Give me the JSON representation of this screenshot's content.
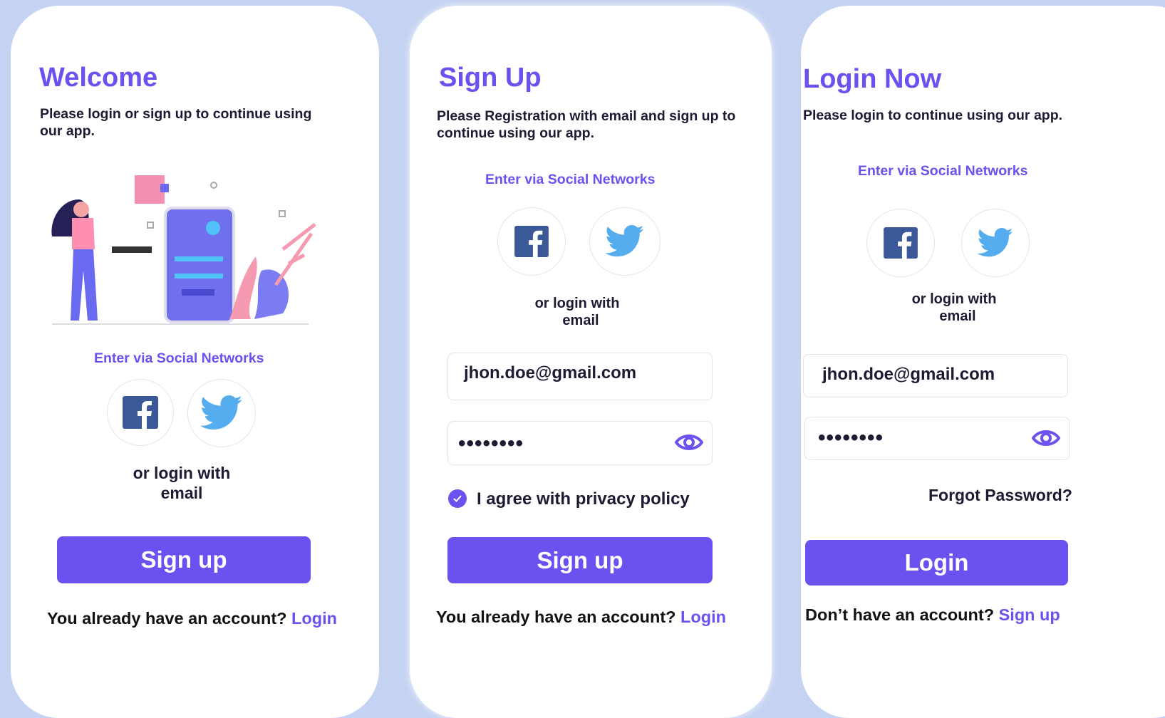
{
  "colors": {
    "accent": "#6a52f0",
    "background": "#c5d3f2",
    "facebook": "#3b5998",
    "twitter": "#55acee"
  },
  "welcome": {
    "title": "Welcome",
    "description": "Please login or sign up to  continue  using our app.",
    "social_label": "Enter via Social Networks",
    "facebook_icon": "facebook-icon",
    "twitter_icon": "twitter-icon",
    "or_login": "or login with",
    "or_login_2": "email",
    "button": "Sign up",
    "footer_text": "You already have an account?",
    "footer_link": "Login"
  },
  "signup": {
    "title": "Sign Up",
    "description": "Please  Registration with email and  sign up to  continue  using  our app.",
    "social_label": "Enter via Social Networks",
    "or_login": "or login with",
    "or_login_2": "email",
    "email_value": "jhon.doe@gmail.com",
    "password_mask": "••••••••",
    "eye_icon": "eye-icon",
    "agree_label": "I agree with privacy policy",
    "agree_checked": true,
    "button": "Sign up",
    "footer_text": "You already have an account?",
    "footer_link": "Login"
  },
  "login": {
    "title": "Login Now",
    "description": "Please  login to continue using our app.",
    "social_label": "Enter via Social Networks",
    "or_login": "or login with",
    "or_login_2": "email",
    "email_value": "jhon.doe@gmail.com",
    "password_mask": "••••••••",
    "forgot": "Forgot Password?",
    "button": "Login",
    "footer_text": "Don’t have an account?",
    "footer_link": "Sign up"
  }
}
